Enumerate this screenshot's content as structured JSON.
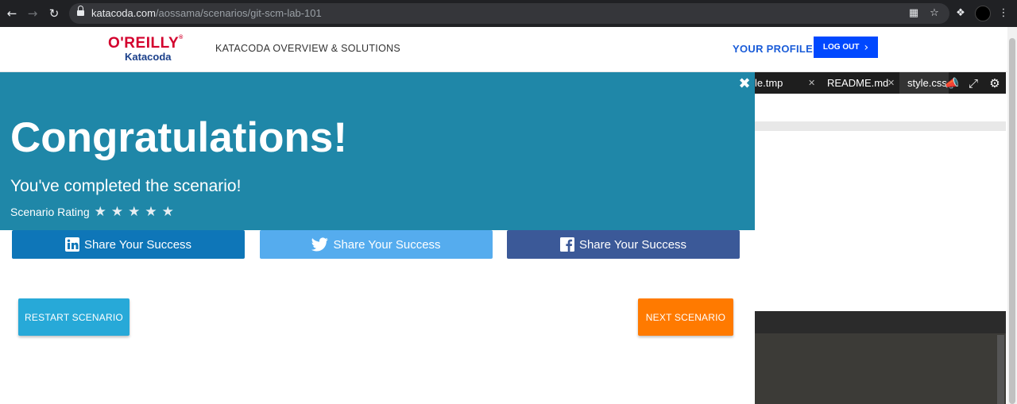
{
  "browser": {
    "url_host": "katacoda.com",
    "url_path": "/aossama/scenarios/git-scm-lab-101",
    "icons": [
      "back-arrow-icon",
      "forward-arrow-icon",
      "reload-icon",
      "lock-icon",
      "translate-icon",
      "star-icon",
      "extensions-icon",
      "menu-icon"
    ]
  },
  "header": {
    "logo_brand": "O'REILLY",
    "logo_sub": "Katacoda",
    "nav_link": "KATACODA OVERVIEW & SOLUTIONS",
    "profile_link": "YOUR PROFILE",
    "logout_label": "LOG OUT"
  },
  "editor": {
    "tabs": [
      {
        "label": "le.tmp"
      },
      {
        "label": "README.md"
      },
      {
        "label": "style.css"
      }
    ]
  },
  "congrats": {
    "title": "Congratulations!",
    "subtitle": "You've completed the scenario!",
    "rating_label": "Scenario Rating",
    "stars": 5
  },
  "share": {
    "linkedin_label": "Share Your Success",
    "twitter_label": "Share Your Success",
    "facebook_label": "Share Your Success"
  },
  "actions": {
    "restart_label": "RESTART SCENARIO",
    "next_label": "NEXT SCENARIO"
  },
  "colors": {
    "congrats_bg": "#1f87a8",
    "linkedin": "#0e76b8",
    "twitter": "#55acee",
    "facebook": "#3b5998",
    "restart": "#27a9d8",
    "next": "#ff7a00",
    "logout": "#0048ff"
  }
}
